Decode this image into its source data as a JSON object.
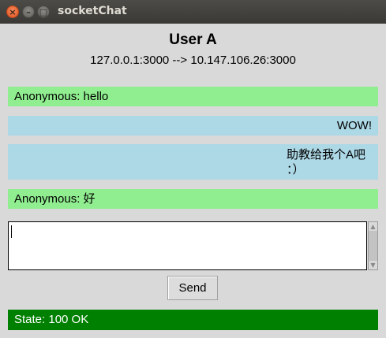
{
  "window": {
    "title": "socketChat",
    "close_glyph": "×",
    "minimize_glyph": "–",
    "maximize_glyph": "□"
  },
  "header": {
    "user": "User A",
    "connection": "127.0.0.1:3000 --> 10.147.106.26:3000"
  },
  "messages": [
    {
      "side": "left",
      "text": "Anonymous: hello",
      "color": "#90ee90"
    },
    {
      "side": "right",
      "text": "WOW!",
      "color": "#add8e6"
    },
    {
      "side": "right",
      "text": "助教给我个A吧 ：）",
      "color": "#add8e6"
    },
    {
      "side": "left",
      "text": "Anonymous: 好",
      "color": "#90ee90"
    }
  ],
  "input": {
    "value": "",
    "scroll_up_icon": "triangle-up-icon",
    "scroll_down_icon": "triangle-down-icon"
  },
  "send_label": "Send",
  "status": {
    "text": "State: 100 OK",
    "color": "#008000"
  }
}
